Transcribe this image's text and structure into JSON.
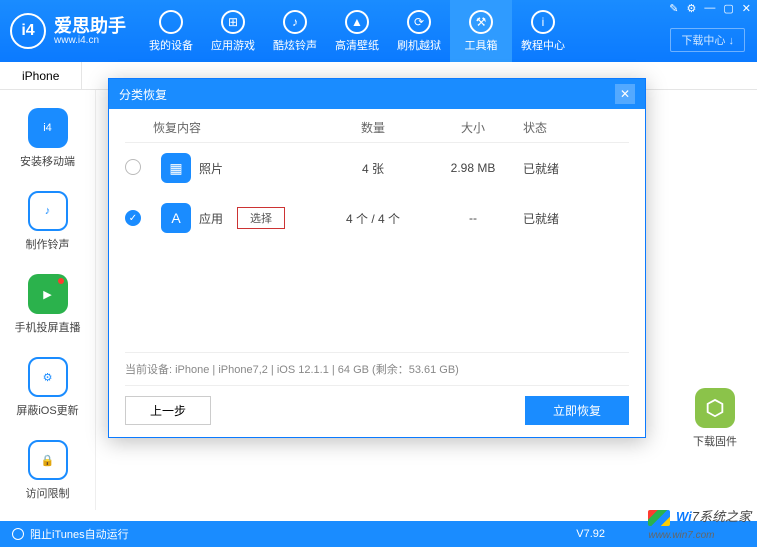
{
  "header": {
    "logo_text": "爱思助手",
    "logo_sub": "www.i4.cn",
    "logo_char": "i4",
    "nav": [
      {
        "label": "我的设备",
        "glyph": ""
      },
      {
        "label": "应用游戏",
        "glyph": "⊞"
      },
      {
        "label": "酷炫铃声",
        "glyph": "♪"
      },
      {
        "label": "高清壁纸",
        "glyph": "▲"
      },
      {
        "label": "刷机越狱",
        "glyph": "⟳"
      },
      {
        "label": "工具箱",
        "glyph": "⚒",
        "active": true
      },
      {
        "label": "教程中心",
        "glyph": "i"
      }
    ],
    "download_center": "下载中心 ↓"
  },
  "tabs": {
    "items": [
      "iPhone"
    ]
  },
  "sidebar": {
    "items": [
      {
        "label": "安装移动端",
        "glyph": "i4"
      },
      {
        "label": "制作铃声",
        "glyph": "♪"
      },
      {
        "label": "手机投屏直播",
        "glyph": "▶"
      },
      {
        "label": "屏蔽iOS更新",
        "glyph": "⚙"
      },
      {
        "label": "访问限制",
        "glyph": "🔒"
      }
    ]
  },
  "right_rail": {
    "label": "下载固件"
  },
  "modal": {
    "title": "分类恢复",
    "columns": {
      "content": "恢复内容",
      "qty": "数量",
      "size": "大小",
      "status": "状态"
    },
    "rows": [
      {
        "checked": false,
        "icon": "▦",
        "name": "照片",
        "qty": "4 张",
        "size": "2.98 MB",
        "status": "已就绪",
        "select_btn": ""
      },
      {
        "checked": true,
        "icon": "A",
        "name": "应用",
        "qty": "4 个 / 4 个",
        "size": "--",
        "status": "已就绪",
        "select_btn": "选择"
      }
    ],
    "device_line": "当前设备: iPhone  |  iPhone7,2 | iOS 12.1.1  |  64 GB  (剩余：53.61 GB)",
    "prev_btn": "上一步",
    "go_btn": "立即恢复"
  },
  "status": {
    "text": "阻止iTunes自动运行",
    "version": "V7.92"
  },
  "watermark": {
    "main_a": "Wi",
    "main_b": "7系统之家",
    "sub": "www.win7.com"
  }
}
